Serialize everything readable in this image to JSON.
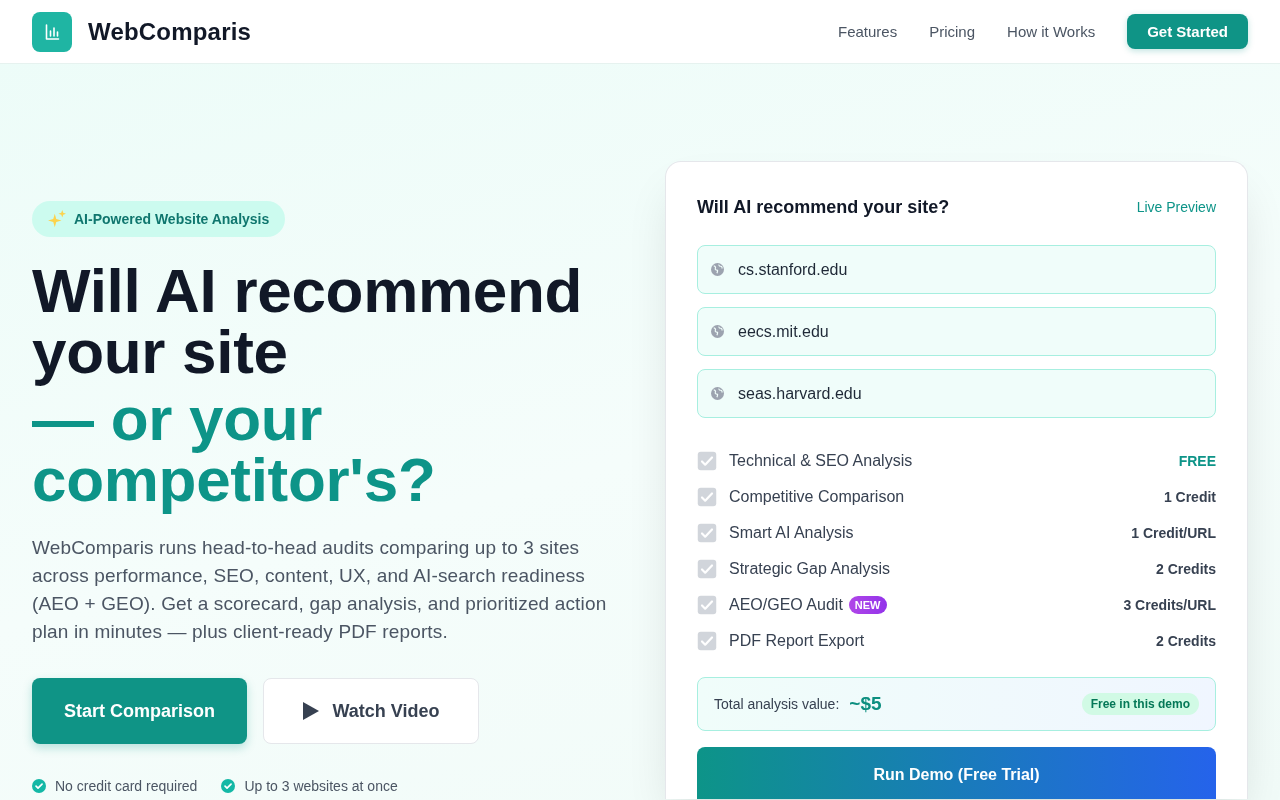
{
  "header": {
    "brand": "WebComparis",
    "nav": [
      "Features",
      "Pricing",
      "How it Works"
    ],
    "cta": "Get Started"
  },
  "hero": {
    "badge": "AI-Powered Website Analysis",
    "title": "Will AI recommend your site",
    "title_accent": "— or your competitor's?",
    "lead": "WebComparis runs head-to-head audits comparing up to 3 sites across performance, SEO, content, UX, and AI-search readiness (AEO + GEO). Get a scorecard, gap analysis, and prioritized action plan in minutes — plus client-ready PDF reports.",
    "buttons": [
      {
        "kind": "primary",
        "label": "Start Comparison"
      },
      {
        "kind": "video",
        "label": "Watch Video"
      }
    ],
    "perks": [
      "No credit card required",
      "Up to 3 websites at once"
    ]
  },
  "demo_card": {
    "title": "Will AI recommend your site?",
    "tag": "Live Preview",
    "urls": [
      {
        "value": "cs.stanford.edu"
      },
      {
        "value": "eecs.mit.edu"
      },
      {
        "value": "seas.harvard.edu"
      }
    ],
    "features": [
      {
        "label": "Technical & SEO Analysis",
        "checked": true,
        "disabled": true,
        "price": "FREE",
        "highlighted": true
      },
      {
        "label": "Competitive Comparison",
        "checked": true,
        "disabled": true,
        "price": "1 Credit",
        "highlighted": false
      },
      {
        "label": "Smart AI Analysis",
        "checked": true,
        "disabled": true,
        "price": "1 Credit/URL",
        "highlighted": false
      },
      {
        "label": "Strategic Gap Analysis",
        "checked": true,
        "disabled": true,
        "price": "2 Credits",
        "highlighted": false
      },
      {
        "label": "AEO/GEO Audit",
        "badge": "NEW",
        "checked": true,
        "disabled": true,
        "price": "3 Credits/URL",
        "highlighted": false
      },
      {
        "label": "PDF Report Export",
        "checked": true,
        "disabled": true,
        "price": "2 Credits",
        "highlighted": false
      }
    ],
    "total": {
      "label": "Total analysis value:",
      "amount": "~$5",
      "note": "Free in this demo"
    },
    "run_button": "Run Demo (Free Trial)"
  }
}
